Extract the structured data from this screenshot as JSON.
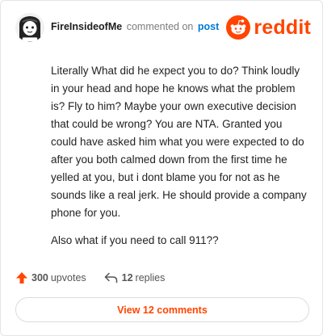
{
  "header": {
    "username": "FireInsideofMe",
    "action_text": "commented on",
    "link_text": "post",
    "brand_name": "reddit",
    "brand_color": "#ff4500",
    "link_color": "#0079d3"
  },
  "comment": {
    "paragraphs": [
      "Literally What did he expect you to do? Think loudly in your head and hope he knows what the problem is? Fly to him? Maybe your own executive decision that could be wrong? You are NTA. Granted you could have asked him what you were expected to do after you both calmed down from the first time he yelled at you, but i dont blame you for not as he sounds like a real jerk. He should provide a company phone for you.",
      "Also what if you need to call 911??"
    ]
  },
  "stats": {
    "upvote_count": "300",
    "upvote_label": "upvotes",
    "reply_count": "12",
    "reply_label": "replies",
    "upvote_icon_color": "#ff4500"
  },
  "footer": {
    "view_comments_label": "View 12 comments"
  },
  "icons": {
    "avatar": "snoo-avatar-icon",
    "brand": "reddit-logo-icon",
    "upvote": "upvote-arrow-icon",
    "reply": "reply-arrow-icon"
  }
}
